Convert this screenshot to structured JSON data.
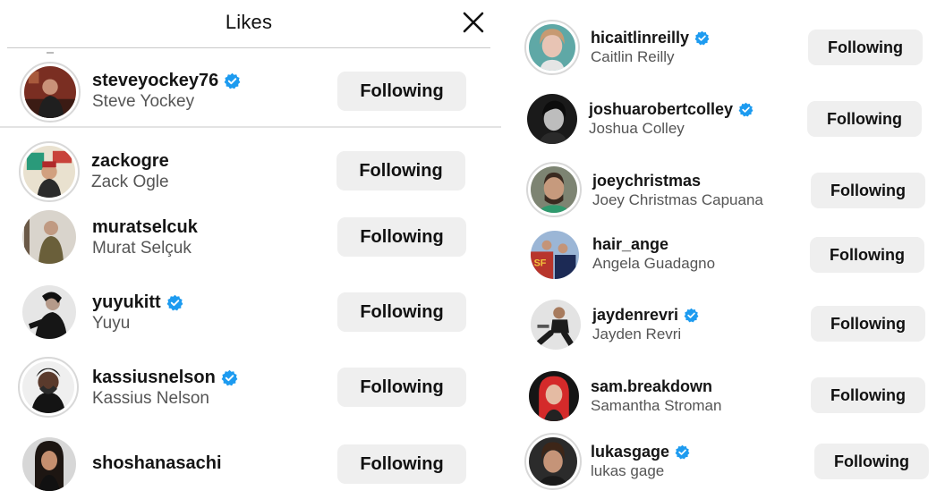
{
  "dialog": {
    "title": "Likes",
    "close_icon": "close-icon"
  },
  "left_users": [
    {
      "username": "steveyockey76",
      "full_name": "Steve Yockey",
      "verified": true,
      "button": "Following"
    },
    {
      "username": "zackogre",
      "full_name": "Zack Ogle",
      "verified": false,
      "button": "Following"
    },
    {
      "username": "muratselcuk",
      "full_name": "Murat Selçuk",
      "verified": false,
      "button": "Following"
    },
    {
      "username": "yuyukitt",
      "full_name": "Yuyu",
      "verified": true,
      "button": "Following"
    },
    {
      "username": "kassiusnelson",
      "full_name": "Kassius Nelson",
      "verified": true,
      "button": "Following"
    },
    {
      "username": "shoshanasachi",
      "full_name": "",
      "verified": false,
      "button": "Following"
    }
  ],
  "right_users": [
    {
      "username": "hicaitlinreilly",
      "full_name": "Caitlin Reilly",
      "verified": true,
      "button": "Following"
    },
    {
      "username": "joshuarobertcolley",
      "full_name": "Joshua Colley",
      "verified": true,
      "button": "Following"
    },
    {
      "username": "joeychristmas",
      "full_name": "Joey Christmas Capuana",
      "verified": false,
      "button": "Following"
    },
    {
      "username": "hair_ange",
      "full_name": "Angela Guadagno",
      "verified": false,
      "button": "Following"
    },
    {
      "username": "jaydenrevri",
      "full_name": "Jayden Revri",
      "verified": true,
      "button": "Following"
    },
    {
      "username": "sam.breakdown",
      "full_name": "Samantha Stroman",
      "verified": false,
      "button": "Following"
    },
    {
      "username": "lukasgage",
      "full_name": "lukas gage",
      "verified": true,
      "button": "Following"
    }
  ],
  "colors": {
    "verified_badge": "#1d9bf0",
    "button_bg": "#efefef"
  },
  "icons": {
    "verified": "verified-badge-icon",
    "avatar": "profile-photo"
  }
}
